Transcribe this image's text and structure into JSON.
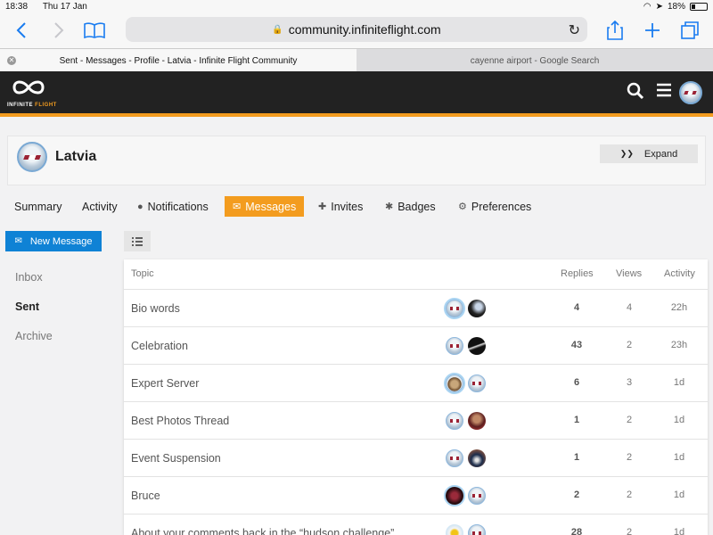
{
  "status_bar": {
    "time": "18:38",
    "date": "Thu 17 Jan",
    "battery": "18%"
  },
  "browser": {
    "url": "community.infiniteflight.com",
    "tabs": [
      {
        "title": "Sent - Messages - Profile - Latvia - Infinite Flight Community",
        "active": true
      },
      {
        "title": "cayenne airport - Google Search",
        "active": false
      }
    ]
  },
  "site": {
    "logo_text_a": "INFINITE",
    "logo_text_b": "FLIGHT",
    "accent_color": "#f39c1f"
  },
  "profile": {
    "name": "Latvia",
    "expand_label": "Expand"
  },
  "nav": {
    "summary": "Summary",
    "activity": "Activity",
    "notifications": "Notifications",
    "messages": "Messages",
    "invites": "Invites",
    "badges": "Badges",
    "preferences": "Preferences"
  },
  "sidebar": {
    "new_message": "New Message",
    "inbox": "Inbox",
    "sent": "Sent",
    "archive": "Archive"
  },
  "table": {
    "headers": {
      "topic": "Topic",
      "replies": "Replies",
      "views": "Views",
      "activity": "Activity"
    },
    "rows": [
      {
        "topic": "Bio words",
        "replies": "4",
        "views": "4",
        "activity": "22h"
      },
      {
        "topic": "Celebration",
        "replies": "43",
        "views": "2",
        "activity": "23h"
      },
      {
        "topic": "Expert Server",
        "replies": "6",
        "views": "3",
        "activity": "1d"
      },
      {
        "topic": "Best Photos Thread",
        "replies": "1",
        "views": "2",
        "activity": "1d"
      },
      {
        "topic": "Event Suspension",
        "replies": "1",
        "views": "2",
        "activity": "1d"
      },
      {
        "topic": "Bruce",
        "replies": "2",
        "views": "2",
        "activity": "1d"
      },
      {
        "topic": "About your comments back in the “hudson challenge”",
        "replies": "28",
        "views": "2",
        "activity": "1d"
      }
    ]
  }
}
